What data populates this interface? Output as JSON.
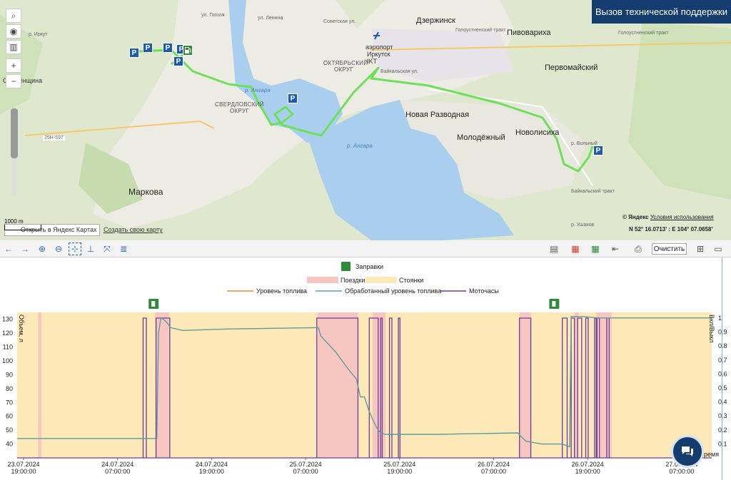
{
  "support": {
    "label": "Вызов технической поддержки"
  },
  "map": {
    "labels": {
      "dzerzhinsk": "Дзержинск",
      "pivovarikha": "Пивовариха",
      "airport": "аэропорт",
      "airport2": "Иркутск",
      "airport3": "IKT",
      "oktyabrsky": "ОКТЯБРЬСКИЙ",
      "okrug1": "ОКРУГ",
      "sverdlovsky": "СВЕРДЛОВСКИЙ",
      "okrug2": "ОКРУГ",
      "pervomaisky": "Первомайский",
      "novaya_razvodnaya": "Новая Разводная",
      "molodezhny": "Молодёжный",
      "novolisikha": "Новолисиха",
      "markova": "Маркова",
      "smolenshchina": "Смолёнщина",
      "sovetskaya": "Советская ул.",
      "golustnensky": "Голоустненский тракт",
      "golustnensky2": "Голоустненский тракт",
      "angara1": "р. Ангара",
      "angara2": "р. Ангара",
      "road_25n": "25Н-597",
      "baikalskaya": "Байкальская ул.",
      "volnaya": "р. Вольный",
      "baikalsky_trakt": "Байкальский тракт",
      "ushakovka": "р. Ушаков",
      "irkut": "р. Иркут",
      "lenina": "ул. Ленина",
      "gogolya": "ул. Гоголя"
    },
    "scale": "1000 m",
    "open_in_yandex": "Открыть в Яндекс Картах",
    "create_map": "Создать свою карту",
    "copyright": "© Яндекс",
    "terms": "Условия использования",
    "coordinates": "N 52° 16.0713' : E 104° 07.0658'",
    "parking_glyph": "P"
  },
  "toolbar": {
    "clear_label": "Очистить"
  },
  "chart_data": {
    "type": "line",
    "title": "",
    "legend_top": "Заправки",
    "legend_row1": [
      "Поездки",
      "Стоянки"
    ],
    "legend_row2": [
      "Уровень топлива",
      "Обработанный уровень топлива",
      "Моточасы"
    ],
    "ylabel_left": "Объем, л",
    "ylabel_right": "Вкл/Выкл",
    "xlabel": "Время",
    "yticks_left": [
      40,
      50,
      60,
      70,
      80,
      90,
      100,
      110,
      120,
      130
    ],
    "yticks_right": [
      0.1,
      0.2,
      0.3,
      0.4,
      0.5,
      0.6,
      0.7,
      0.8,
      0.9,
      1
    ],
    "xticks": [
      {
        "date": "23.07.2024",
        "time": "19:00:00"
      },
      {
        "date": "24.07.2024",
        "time": "07:00:00"
      },
      {
        "date": "24.07.2024",
        "time": "19:00:00"
      },
      {
        "date": "25.07.2024",
        "time": "07:00:00"
      },
      {
        "date": "25.07.2024",
        "time": "19:00:00"
      },
      {
        "date": "26.07.2024",
        "time": "07:00:00"
      },
      {
        "date": "26.07.2024",
        "time": "19:00:00"
      },
      {
        "date": "27.07.2024",
        "time": "07:00:00"
      }
    ],
    "colors": {
      "trips": "#f7c6c0",
      "parking": "#fde9b8",
      "fuel": "#e88a3a",
      "processed": "#5e9ea0",
      "engine": "#6a3d9a"
    },
    "ylim": [
      30,
      135
    ],
    "x_hours": [
      0,
      86
    ],
    "trips_hours": [
      [
        2.6,
        3.0
      ],
      [
        17.1,
        18.8
      ],
      [
        37.2,
        42.2
      ],
      [
        44.0,
        45.6
      ],
      [
        62.2,
        63.6
      ],
      [
        69.0,
        69.5
      ],
      [
        71.7,
        73.6
      ],
      [
        72.9,
        73.1
      ]
    ],
    "fuel_series": [
      [
        0,
        44
      ],
      [
        17.0,
        44
      ],
      [
        17.3,
        44
      ],
      [
        17.5,
        120
      ],
      [
        17.8,
        131
      ],
      [
        18.1,
        130
      ],
      [
        18.5,
        128
      ],
      [
        19.0,
        124
      ],
      [
        20.5,
        122
      ],
      [
        26.0,
        123
      ],
      [
        37.0,
        124
      ],
      [
        37.3,
        124
      ],
      [
        37.6,
        118
      ],
      [
        39.5,
        106
      ],
      [
        41.0,
        94
      ],
      [
        42.0,
        87
      ],
      [
        42.5,
        74
      ],
      [
        43.0,
        74
      ],
      [
        43.5,
        65
      ],
      [
        44.0,
        58
      ],
      [
        44.5,
        52
      ],
      [
        45.0,
        48
      ],
      [
        45.6,
        47
      ],
      [
        52.0,
        47
      ],
      [
        62.0,
        48
      ],
      [
        62.3,
        46
      ],
      [
        63.0,
        42
      ],
      [
        65.0,
        40
      ],
      [
        67.5,
        40
      ],
      [
        68.4,
        38
      ],
      [
        68.6,
        132
      ],
      [
        70.0,
        132
      ],
      [
        72.0,
        131
      ],
      [
        86,
        131
      ]
    ],
    "engine_events": [
      [
        15.6,
        16.0
      ],
      [
        17.2,
        18.9
      ],
      [
        37.1,
        42.2
      ],
      [
        43.6,
        44.7
      ],
      [
        45.0,
        45.2
      ],
      [
        46.1,
        46.4
      ],
      [
        47.2,
        47.4
      ],
      [
        62.2,
        63.6
      ],
      [
        67.5,
        68.1
      ],
      [
        68.6,
        69.0
      ],
      [
        69.4,
        69.9
      ],
      [
        70.4,
        70.7
      ],
      [
        71.5,
        71.7
      ],
      [
        71.8,
        72.1
      ],
      [
        73.0,
        73.3
      ]
    ],
    "fuel_icons_hours": [
      16.9,
      66.5
    ]
  }
}
